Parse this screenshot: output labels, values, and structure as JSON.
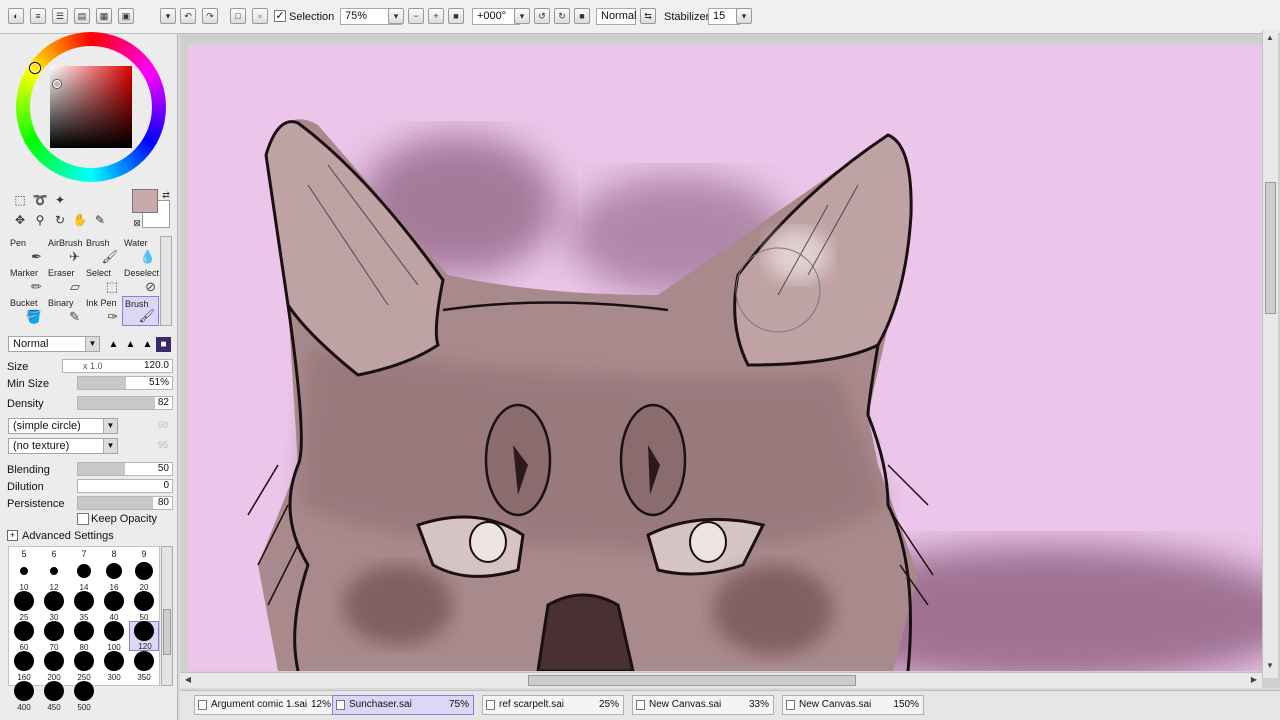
{
  "toolbar": {
    "selection_label": "Selection",
    "zoom_value": "75%",
    "rotation_value": "+000°",
    "blend_mode": "Normal",
    "stabilizer_label": "Stabilizer",
    "stabilizer_value": "15"
  },
  "tools": [
    {
      "label": "Pen",
      "icon": "pen-icon"
    },
    {
      "label": "AirBrush",
      "icon": "airbrush-icon"
    },
    {
      "label": "Brush",
      "icon": "brush-icon"
    },
    {
      "label": "Water",
      "icon": "water-icon"
    },
    {
      "label": "Marker",
      "icon": "marker-icon"
    },
    {
      "label": "Eraser",
      "icon": "eraser-icon"
    },
    {
      "label": "Select",
      "icon": "select-icon"
    },
    {
      "label": "Deselect",
      "icon": "deselect-icon"
    },
    {
      "label": "Bucket",
      "icon": "bucket-icon"
    },
    {
      "label": "Binary",
      "icon": "binary-icon"
    },
    {
      "label": "Ink Pen",
      "icon": "inkpen-icon"
    },
    {
      "label": "Brush",
      "icon": "brush-icon"
    }
  ],
  "selected_tool_index": 11,
  "brush_settings": {
    "blend_mode": "Normal",
    "size_label": "Size",
    "size_multiplier": "x 1.0",
    "size_value": "120.0",
    "min_size_label": "Min Size",
    "min_size_value": "51%",
    "min_size_fraction": 0.51,
    "density_label": "Density",
    "density_value": "82",
    "density_fraction": 0.82,
    "shape": "(simple circle)",
    "shape_strength": "50",
    "texture": "(no texture)",
    "texture_strength": "95",
    "blending_label": "Blending",
    "blending_value": "50",
    "blending_fraction": 0.5,
    "dilution_label": "Dilution",
    "dilution_value": "0",
    "dilution_fraction": 0,
    "persistence_label": "Persistence",
    "persistence_value": "80",
    "persistence_fraction": 0.8,
    "keep_opacity_label": "Keep Opacity",
    "advanced_label": "Advanced Settings"
  },
  "brush_sizes": {
    "header": [
      "5",
      "6",
      "7",
      "8",
      "9"
    ],
    "rows": [
      [
        "10",
        "12",
        "14",
        "16",
        "20"
      ],
      [
        "25",
        "30",
        "35",
        "40",
        "50"
      ],
      [
        "60",
        "70",
        "80",
        "100",
        "120"
      ],
      [
        "160",
        "200",
        "250",
        "300",
        "350"
      ],
      [
        "400",
        "450",
        "500"
      ]
    ],
    "selected": "120"
  },
  "colors": {
    "current": "#c7aaa9",
    "canvas_bg": "#ecc6ea",
    "accent": "#8a7fd6"
  },
  "tabs": [
    {
      "name": "Argument comic 1.sai",
      "zoom": "12%"
    },
    {
      "name": "Sunchaser.sai",
      "zoom": "75%"
    },
    {
      "name": "ref scarpelt.sai",
      "zoom": "25%"
    },
    {
      "name": "New Canvas.sai",
      "zoom": "33%"
    },
    {
      "name": "New Canvas.sai",
      "zoom": "150%"
    }
  ],
  "active_tab_index": 1
}
